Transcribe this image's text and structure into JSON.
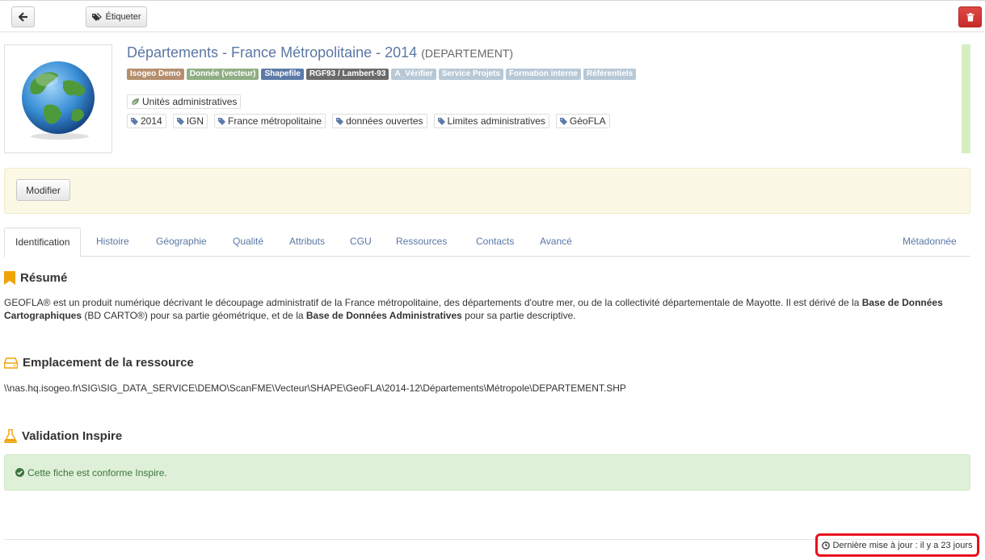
{
  "toolbar": {
    "back_icon": "arrow-left-icon",
    "tag_button_label": "Étiqueter",
    "tag_icon": "tags-icon",
    "delete_icon": "trash-icon",
    "delete_color": "#d9534f"
  },
  "header": {
    "thumbnail_icon": "globe-icon",
    "title": "Départements - France Métropolitaine - 2014",
    "technical_name": "(DEPARTEMENT)",
    "labels": [
      {
        "text": "Isogeo Demo",
        "color": "#b58f6e"
      },
      {
        "text": "Donnée (vecteur)",
        "color": "#8fae83"
      },
      {
        "text": "Shapefile",
        "color": "#5b7aa8"
      },
      {
        "text": "RGF93 / Lambert-93",
        "color": "#6a6a6a"
      },
      {
        "text": "A_Vérifier",
        "color": "#b7c8d6"
      },
      {
        "text": "Service Projets",
        "color": "#b7c8d6"
      },
      {
        "text": "Formation interne",
        "color": "#b7c8d6"
      },
      {
        "text": "Référentiels",
        "color": "#b7c8d6"
      }
    ],
    "inspire_theme": {
      "text": "Unités administratives",
      "icon": "leaf-icon"
    },
    "keywords": [
      "2014",
      "IGN",
      "France métropolitaine",
      "données ouvertes",
      "Limites administratives",
      "GéoFLA"
    ],
    "keyword_icon": "tag-icon"
  },
  "actions": {
    "modify_label": "Modifier"
  },
  "tabs": [
    {
      "label": "Identification",
      "active": true
    },
    {
      "label": "Histoire"
    },
    {
      "label": "Géographie"
    },
    {
      "label": "Qualité"
    },
    {
      "label": "Attributs"
    },
    {
      "label": "CGU"
    },
    {
      "label": "Ressources"
    },
    {
      "label": "Contacts"
    },
    {
      "label": "Avancé"
    },
    {
      "label": "Métadonnée"
    }
  ],
  "resume": {
    "title": "Résumé",
    "icon": "bookmark-icon",
    "text_1": "GEOFLA® est un produit numérique décrivant le découpage administratif de la France métropolitaine, des départements d'outre mer, ou de la collectivité départementale de Mayotte. Il est dérivé de la ",
    "bold_1": "Base de Données Cartographiques",
    "text_2": " (BD CARTO®) pour sa partie géométrique, et de la ",
    "bold_2": "Base de Données Administratives",
    "text_3": " pour sa partie descriptive."
  },
  "location": {
    "title": "Emplacement de la ressource",
    "icon": "hdd-icon",
    "path": "\\\\nas.hq.isogeo.fr\\SIG\\SIG_DATA_SERVICE\\DEMO\\ScanFME\\Vecteur\\SHAPE\\GeoFLA\\2014-12\\Départements\\Métropole\\DEPARTEMENT.SHP"
  },
  "inspire": {
    "title": "Validation Inspire",
    "icon": "flask-icon",
    "message": "Cette fiche est conforme Inspire.",
    "message_icon": "check-circle-icon"
  },
  "footer": {
    "last_update": "Dernière mise à jour : il y a 23 jours",
    "clock_icon": "clock-icon",
    "highlight_color": "#e8101e"
  }
}
